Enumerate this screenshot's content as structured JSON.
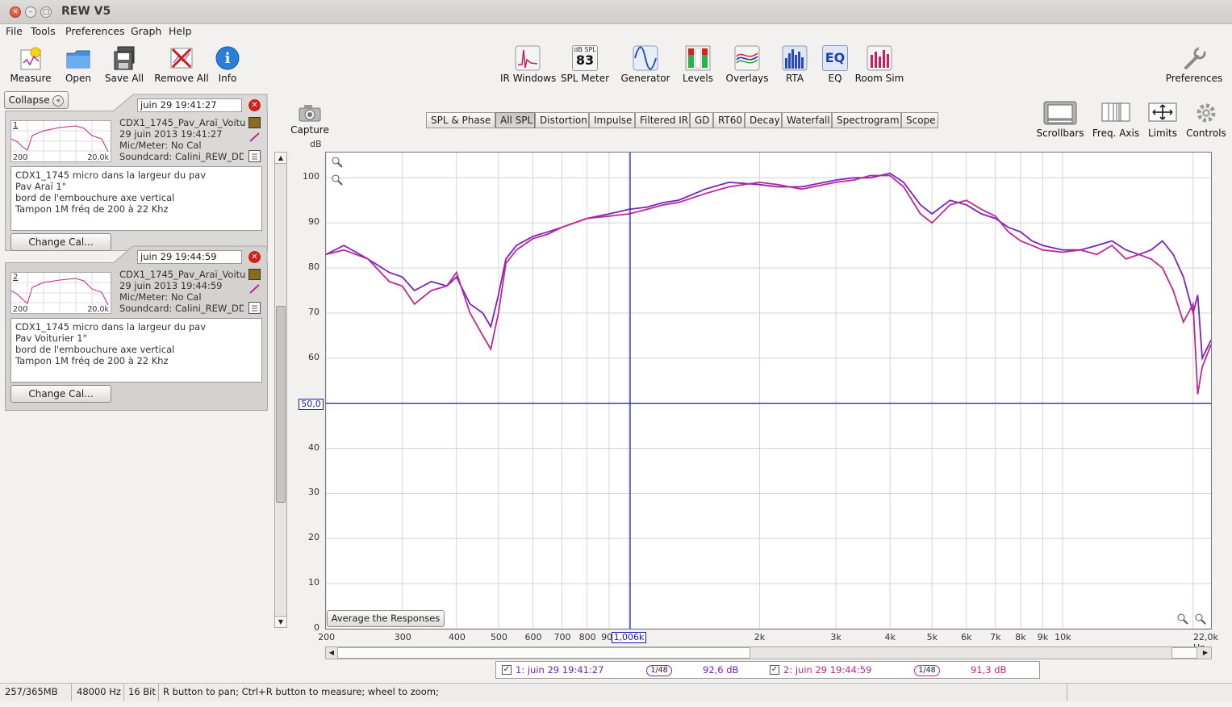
{
  "window": {
    "title": "REW V5"
  },
  "menu": [
    "File",
    "Tools",
    "Preferences",
    "Graph",
    "Help"
  ],
  "toolbar_left": [
    {
      "label": "Measure",
      "icon": "measure-icon"
    },
    {
      "label": "Open",
      "icon": "folder-icon"
    },
    {
      "label": "Save All",
      "icon": "save-all-icon"
    },
    {
      "label": "Remove All",
      "icon": "remove-all-icon"
    },
    {
      "label": "Info",
      "icon": "info-icon"
    }
  ],
  "toolbar_center": [
    {
      "label": "IR Windows",
      "icon": "ir-windows-icon"
    },
    {
      "label": "SPL Meter",
      "icon": "spl-meter-icon",
      "badge_top": "dB SPL",
      "badge_value": "83"
    },
    {
      "label": "Generator",
      "icon": "generator-icon"
    },
    {
      "label": "Levels",
      "icon": "levels-icon"
    },
    {
      "label": "Overlays",
      "icon": "overlays-icon"
    },
    {
      "label": "RTA",
      "icon": "rta-icon"
    },
    {
      "label": "EQ",
      "icon": "eq-icon",
      "badge_value": "EQ"
    },
    {
      "label": "Room Sim",
      "icon": "room-sim-icon"
    }
  ],
  "toolbar_right": {
    "label": "Preferences",
    "icon": "wrench-icon"
  },
  "left_panel": {
    "collapse_label": "Collapse",
    "measurements": [
      {
        "index": "1",
        "name_field": "juin 29 19:41:27",
        "title": "CDX1_1745_Pav_Araï_Voitu",
        "date": "29 juin 2013 19:41:27",
        "mic": "Mic/Meter: No Cal",
        "soundcard": "Soundcard: Calini_REW_DDI",
        "thumb_min": "200",
        "thumb_max": "20,0k",
        "notes": [
          "CDX1_1745 micro dans la largeur du pav",
          "Pav Araï 1\"",
          "bord de l'embouchure axe vertical",
          "Tampon 1M fréq de 200 à 22 Khz"
        ],
        "change_cal": "Change Cal..."
      },
      {
        "index": "2",
        "name_field": "juin 29 19:44:59",
        "title": "CDX1_1745_Pav_Araï_Voitu",
        "date": "29 juin 2013 19:44:59",
        "mic": "Mic/Meter: No Cal",
        "soundcard": "Soundcard: Calini_REW_DDI",
        "thumb_min": "200",
        "thumb_max": "20,0k",
        "notes": [
          "CDX1_1745 micro dans la largeur du pav",
          "Pav Voiturier 1\"",
          "bord de l'embouchure axe vertical",
          "Tampon 1M fréq de 200 à 22 Khz"
        ],
        "change_cal": "Change Cal..."
      }
    ]
  },
  "capture": {
    "label": "Capture"
  },
  "tabs": [
    {
      "label": "SPL & Phase",
      "selected": false
    },
    {
      "label": "All SPL",
      "selected": true
    },
    {
      "label": "Distortion",
      "selected": false
    },
    {
      "label": "Impulse",
      "selected": false
    },
    {
      "label": "Filtered IR",
      "selected": false
    },
    {
      "label": "GD",
      "selected": false
    },
    {
      "label": "RT60",
      "selected": false
    },
    {
      "label": "Decay",
      "selected": false
    },
    {
      "label": "Waterfall",
      "selected": false
    },
    {
      "label": "Spectrogram",
      "selected": false
    },
    {
      "label": "Scope",
      "selected": false
    }
  ],
  "graph_tools": [
    {
      "label": "Scrollbars",
      "icon": "scrollbars-icon"
    },
    {
      "label": "Freq. Axis",
      "icon": "freq-axis-icon"
    },
    {
      "label": "Limits",
      "icon": "limits-icon"
    },
    {
      "label": "Controls",
      "icon": "gear-icon"
    }
  ],
  "graph": {
    "y_unit": "dB",
    "cursor_y_label": "50,0",
    "cursor_x_label": "1,006k",
    "average_button": "Average the Responses"
  },
  "legend": [
    {
      "checked": true,
      "label": "1: juin 29 19:41:27",
      "smoothing": "1/48",
      "value": "92,6 dB"
    },
    {
      "checked": true,
      "label": "2: juin 29 19:44:59",
      "smoothing": "1/48",
      "value": "91,3 dB"
    }
  ],
  "status": {
    "memory": "257/365MB",
    "rate": "48000 Hz",
    "bits": "16 Bit",
    "hint": "R button to pan; Ctrl+R button to measure; wheel to zoom;"
  },
  "chart_data": {
    "type": "line",
    "ylabel": "dB",
    "ylim": [
      0,
      105
    ],
    "xlim": [
      200,
      22000
    ],
    "x_scale": "log",
    "y_ticks": [
      0,
      10,
      20,
      30,
      40,
      50,
      60,
      70,
      80,
      90,
      100
    ],
    "x_tick_labels": [
      "200",
      "300",
      "400",
      "500",
      "600",
      "700",
      "800",
      "900",
      "1,006k",
      "2k",
      "3k",
      "4k",
      "5k",
      "6k",
      "7k",
      "8k",
      "9k",
      "10k",
      "22,0k Hz"
    ],
    "x_tick_values": [
      200,
      300,
      400,
      500,
      600,
      700,
      800,
      900,
      1006,
      2000,
      3000,
      4000,
      5000,
      6000,
      7000,
      8000,
      9000,
      10000,
      22000
    ],
    "cursor": {
      "x": 1006,
      "y": 50
    },
    "series": [
      {
        "name": "1: juin 29 19:41:27",
        "color": "#7b22c2",
        "x": [
          200,
          220,
          250,
          280,
          300,
          320,
          350,
          380,
          400,
          430,
          460,
          480,
          500,
          520,
          550,
          600,
          650,
          700,
          800,
          900,
          1000,
          1100,
          1200,
          1300,
          1500,
          1700,
          2000,
          2200,
          2500,
          3000,
          3300,
          3600,
          4000,
          4300,
          4700,
          5000,
          5500,
          6000,
          6500,
          7000,
          7500,
          8000,
          8500,
          9000,
          10000,
          11000,
          12000,
          13000,
          14000,
          15000,
          16000,
          17000,
          18000,
          19000,
          20000,
          20500,
          21000,
          22000
        ],
        "y": [
          83,
          85,
          82,
          79,
          78,
          75,
          77,
          76,
          78,
          72,
          70,
          67,
          74,
          82,
          85,
          87,
          88,
          89,
          91,
          92,
          93,
          93.5,
          94.5,
          95,
          97.5,
          99,
          98.5,
          98,
          98,
          99.5,
          100,
          100,
          101,
          99,
          94,
          92,
          95,
          94,
          92,
          91,
          89,
          88,
          86,
          85,
          84,
          84,
          85,
          86,
          84,
          83,
          84,
          86,
          83,
          78,
          70,
          74,
          60,
          64
        ]
      },
      {
        "name": "2: juin 29 19:44:59",
        "color": "#c0288f",
        "x": [
          200,
          220,
          250,
          280,
          300,
          320,
          350,
          380,
          400,
          430,
          460,
          480,
          500,
          520,
          550,
          600,
          650,
          700,
          800,
          900,
          1000,
          1100,
          1200,
          1300,
          1500,
          1700,
          2000,
          2200,
          2500,
          3000,
          3300,
          3600,
          4000,
          4300,
          4700,
          5000,
          5500,
          6000,
          6500,
          7000,
          7500,
          8000,
          8500,
          9000,
          10000,
          11000,
          12000,
          13000,
          14000,
          15000,
          16000,
          17000,
          18000,
          19000,
          20000,
          20500,
          21000,
          22000
        ],
        "y": [
          83,
          84,
          82,
          77,
          76,
          72,
          75,
          76,
          79,
          70,
          65,
          62,
          70,
          81,
          84,
          86.5,
          87.5,
          89,
          91,
          91.5,
          92,
          93,
          94,
          94.5,
          96.5,
          98,
          99,
          98.5,
          97.5,
          99,
          99.5,
          100.5,
          100.5,
          98,
          92,
          90,
          94,
          95,
          93,
          91.5,
          88,
          86,
          85,
          84,
          83.5,
          84,
          83,
          85,
          82,
          83,
          82,
          80,
          75,
          68,
          72,
          52,
          58,
          63
        ]
      }
    ]
  }
}
